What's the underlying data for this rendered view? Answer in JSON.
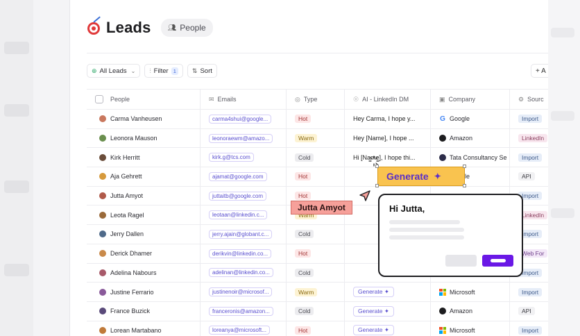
{
  "page": {
    "title": "Leads",
    "people_badge": "People"
  },
  "toolbar": {
    "all_leads": "All Leads",
    "filter": "Filter",
    "filter_count": "1",
    "sort": "Sort",
    "add": "+ A"
  },
  "columns": {
    "people": "People",
    "emails": "Emails",
    "type": "Type",
    "ai": "AI - LinkedIn DM",
    "company": "Company",
    "source": "Sourc"
  },
  "rows": [
    {
      "name": "Carma Vanheusen",
      "email": "carma4shui@google...",
      "type": "Hot",
      "ai": "Hey Carma, I hope y...",
      "company": "Google",
      "source": "Import"
    },
    {
      "name": "Leonora Mauson",
      "email": "leonoraewm@amazo...",
      "type": "Warm",
      "ai": "Hey [Name], I hope ...",
      "company": "Amazon",
      "source": "LinkedIn"
    },
    {
      "name": "Kirk Herritt",
      "email": "kirk.g@tcs.com",
      "type": "Cold",
      "ai": "Hi [Name], I hope thi...",
      "company": "Tata Consultancy Se",
      "source": "Import"
    },
    {
      "name": "Aja Gehrett",
      "email": "ajamat@google.com",
      "type": "Hot",
      "ai": "",
      "company": "Google",
      "source": "API"
    },
    {
      "name": "Jutta Amyot",
      "email": "juttaitb@google.com",
      "type": "Hot",
      "ai": "",
      "company": "",
      "source": "Import"
    },
    {
      "name": "Leota Ragel",
      "email": "leotaan@linkedin.c...",
      "type": "Warm",
      "ai": "",
      "company": "",
      "source": "LinkedIn"
    },
    {
      "name": "Jerry Dallen",
      "email": "jerry.ajain@globant.c...",
      "type": "Cold",
      "ai": "",
      "company": "",
      "source": "Import"
    },
    {
      "name": "Derick Dhamer",
      "email": "derikvin@linkedin.co...",
      "type": "Hot",
      "ai": "",
      "company": "",
      "source": "Web For"
    },
    {
      "name": "Adelina Nabours",
      "email": "adelinan@linkedin.co...",
      "type": "Cold",
      "ai": "",
      "company": "",
      "source": "Import"
    },
    {
      "name": "Justine Ferrario",
      "email": "justinenoir@microsof...",
      "type": "Warm",
      "ai": "Generate",
      "company": "Microsoft",
      "source": "Import"
    },
    {
      "name": "France Buzick",
      "email": "franceronis@amazon...",
      "type": "Cold",
      "ai": "Generate",
      "company": "Amazon",
      "source": "API"
    },
    {
      "name": "Lorean Martabano",
      "email": "loreanya@microsoft...",
      "type": "Hot",
      "ai": "Generate",
      "company": "Microsoft",
      "source": "Import"
    }
  ],
  "overlay": {
    "generate_label": "Generate",
    "cursor_name": "Jutta Amyot",
    "popup_title": "Hi Jutta,"
  },
  "colors": {
    "accent": "#6a18e6",
    "generate_bg": "#f9c34f",
    "name_tag_bg": "#f6a09a"
  }
}
